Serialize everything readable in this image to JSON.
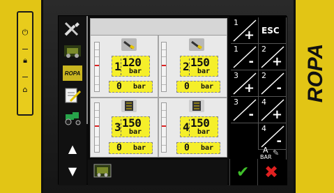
{
  "brand": "ROPA",
  "side_panel": {
    "buttons": [
      "power-icon",
      "lock-icon",
      "home-icon"
    ]
  },
  "sidebar": {
    "items": [
      {
        "name": "tools-icon"
      },
      {
        "name": "machine-icon"
      },
      {
        "name": "ropa-logo",
        "label": "ROPA"
      },
      {
        "name": "checklist-icon"
      },
      {
        "name": "tractor-icon"
      }
    ],
    "up": "▲",
    "down": "▼"
  },
  "cells": [
    {
      "num": "1",
      "setpoint": "120",
      "unit": "bar",
      "actual": "0",
      "actual_unit": "bar"
    },
    {
      "num": "2",
      "setpoint": "150",
      "unit": "bar",
      "actual": "0",
      "actual_unit": "bar"
    },
    {
      "num": "3",
      "setpoint": "150",
      "unit": "bar",
      "actual": "0",
      "actual_unit": "bar"
    },
    {
      "num": "4",
      "setpoint": "150",
      "unit": "bar",
      "actual": "0",
      "actual_unit": "bar"
    }
  ],
  "keypad": {
    "esc": "ESC",
    "ab_top": "A",
    "ab_bottom": "BAR",
    "keys": [
      {
        "top": "1",
        "sign": "+"
      },
      {
        "top": "1",
        "sign": "-"
      },
      {
        "top": "2",
        "sign": "+"
      },
      {
        "top": "3",
        "sign": "+"
      },
      {
        "top": "2",
        "sign": "-"
      },
      {
        "top": "3",
        "sign": "-"
      },
      {
        "top": "4",
        "sign": "+"
      },
      {
        "top": "4",
        "sign": "-"
      }
    ]
  },
  "bottom": {
    "confirm": "✔",
    "cancel": "✖"
  },
  "colors": {
    "accent_yellow": "#e2c515",
    "display_yellow": "#f5ef2a",
    "confirm": "#3fbf2a",
    "cancel": "#e02020"
  }
}
